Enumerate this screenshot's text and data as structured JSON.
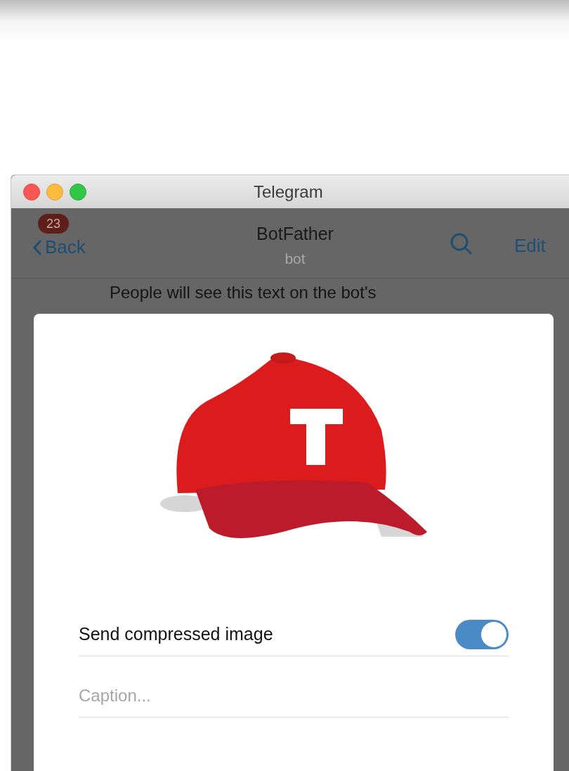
{
  "window": {
    "title": "Telegram"
  },
  "header": {
    "back": "Back",
    "unread_badge": "23",
    "title": "BotFather",
    "subtitle": "bot",
    "edit": "Edit"
  },
  "chat": {
    "message": "People will see this text on the bot's"
  },
  "dialog": {
    "compress": {
      "label": "Send compressed image",
      "on": true
    },
    "caption": {
      "placeholder": "Caption..."
    }
  }
}
